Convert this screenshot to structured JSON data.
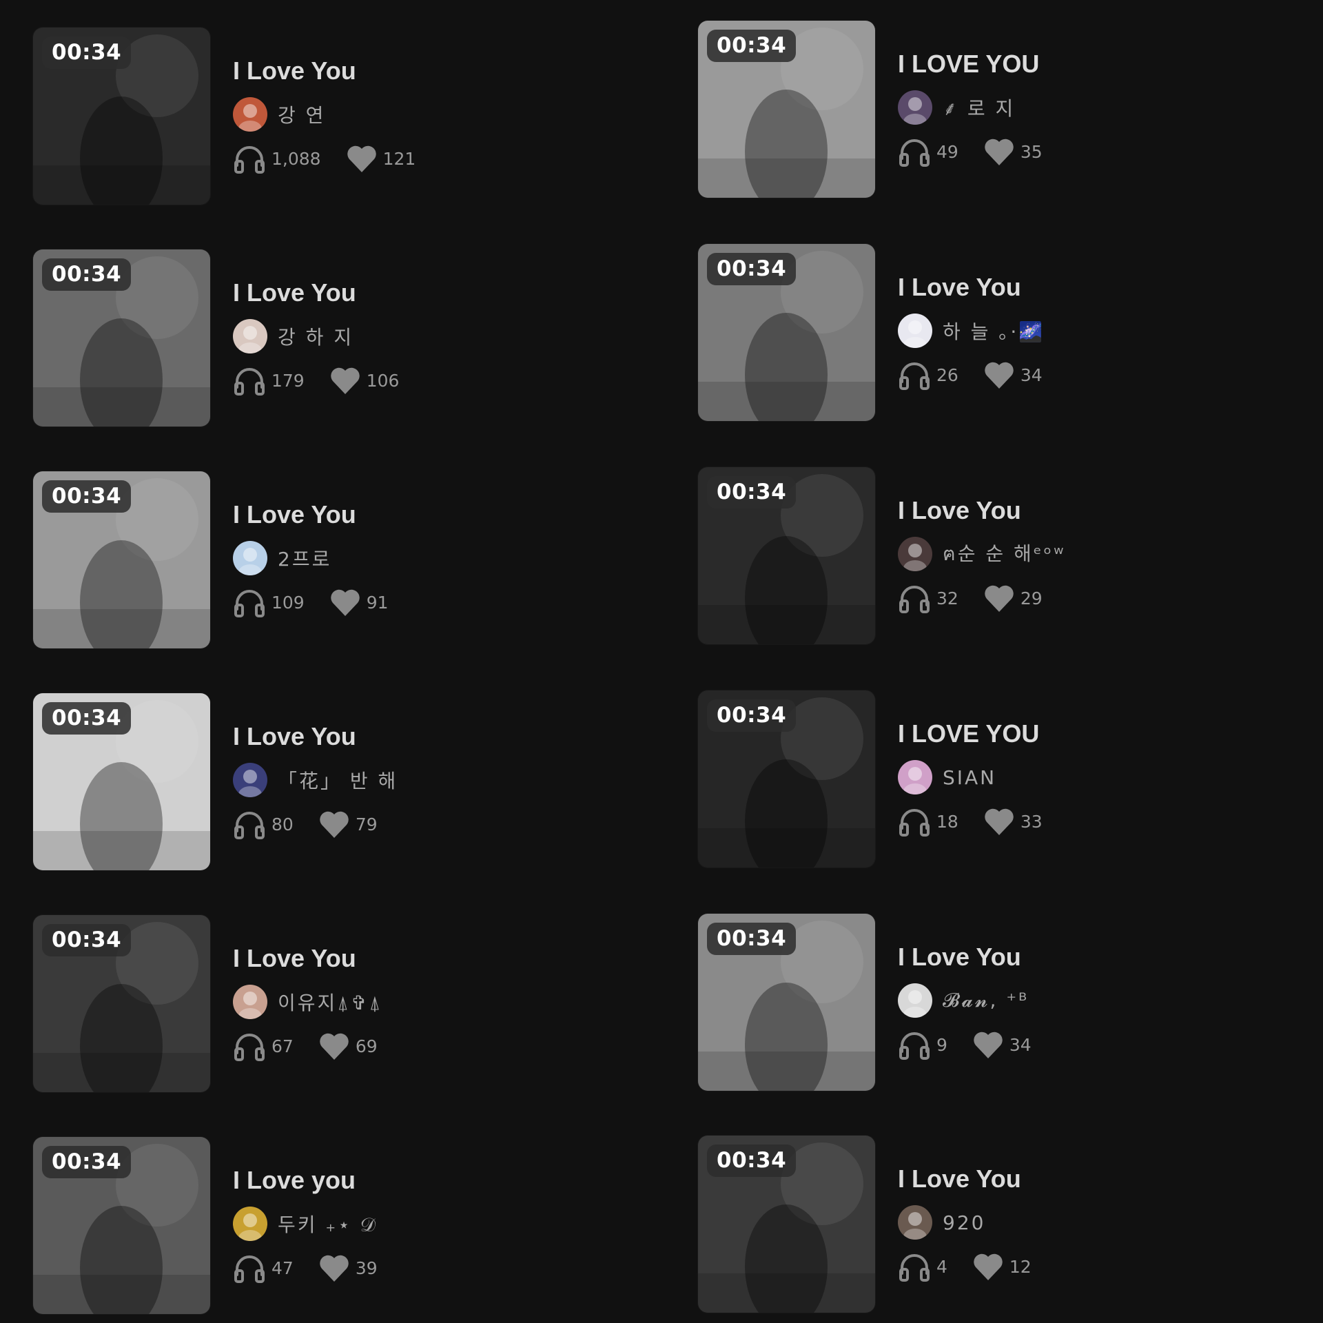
{
  "colors": {
    "background": "#111111",
    "title": "#dcdcdc",
    "meta": "#9a9a9a",
    "badge_bg": "#2d2d2d"
  },
  "left_column": [
    {
      "duration": "00:34",
      "title": "I Love You",
      "creator": "강 연",
      "plays": "1,088",
      "likes": "121",
      "thumb_tone": "#2a2a2a",
      "avatar_tone": "#c0583a"
    },
    {
      "duration": "00:34",
      "title": "I Love You",
      "creator": "강 하 지",
      "plays": "179",
      "likes": "106",
      "thumb_tone": "#6a6a6a",
      "avatar_tone": "#d9c8c0"
    },
    {
      "duration": "00:34",
      "title": "I Love You",
      "creator": "2프로",
      "plays": "109",
      "likes": "91",
      "thumb_tone": "#9a9a9a",
      "avatar_tone": "#b8d0e8"
    },
    {
      "duration": "00:34",
      "title": "I Love You",
      "creator": "「花」 반 해",
      "plays": "80",
      "likes": "79",
      "thumb_tone": "#d0d0d0",
      "avatar_tone": "#3a3f7a"
    },
    {
      "duration": "00:34",
      "title": "I Love You",
      "creator": "이유지⍋✞⍋",
      "plays": "67",
      "likes": "69",
      "thumb_tone": "#3a3a3a",
      "avatar_tone": "#c8a090"
    },
    {
      "duration": "00:34",
      "title": "I Love you",
      "creator": "두키 ₊⋆ 𝒟",
      "plays": "47",
      "likes": "39",
      "thumb_tone": "#5a5a5a",
      "avatar_tone": "#c8a030"
    }
  ],
  "right_column": [
    {
      "duration": "00:34",
      "title": "I LOVE YOU",
      "creator": "⸙ 로 지",
      "plays": "49",
      "likes": "35",
      "thumb_tone": "#9a9a9a",
      "avatar_tone": "#5a4a6a"
    },
    {
      "duration": "00:34",
      "title": "I Love You",
      "creator": "하 늘 ｡·🌌",
      "plays": "26",
      "likes": "34",
      "thumb_tone": "#7a7a7a",
      "avatar_tone": "#e8e8f0"
    },
    {
      "duration": "00:34",
      "title": "I Love You",
      "creator": "ฅ순 순 해ᵉᵒʷ",
      "plays": "32",
      "likes": "29",
      "thumb_tone": "#2a2a2a",
      "avatar_tone": "#4a3a3a"
    },
    {
      "duration": "00:34",
      "title": "I LOVE YOU",
      "creator": "SIAN",
      "plays": "18",
      "likes": "33",
      "thumb_tone": "#262626",
      "avatar_tone": "#d0a0c8"
    },
    {
      "duration": "00:34",
      "title": "I Love You",
      "creator": "𝓑𝓪𝓷, ⁺ᴮ",
      "plays": "9",
      "likes": "34",
      "thumb_tone": "#8a8a8a",
      "avatar_tone": "#d8d8d8"
    },
    {
      "duration": "00:34",
      "title": "I Love You",
      "creator": "920",
      "plays": "4",
      "likes": "12",
      "thumb_tone": "#3a3a3a",
      "avatar_tone": "#6a5a50"
    }
  ],
  "icons": {
    "plays": "headphones-icon",
    "likes": "heart-icon"
  }
}
